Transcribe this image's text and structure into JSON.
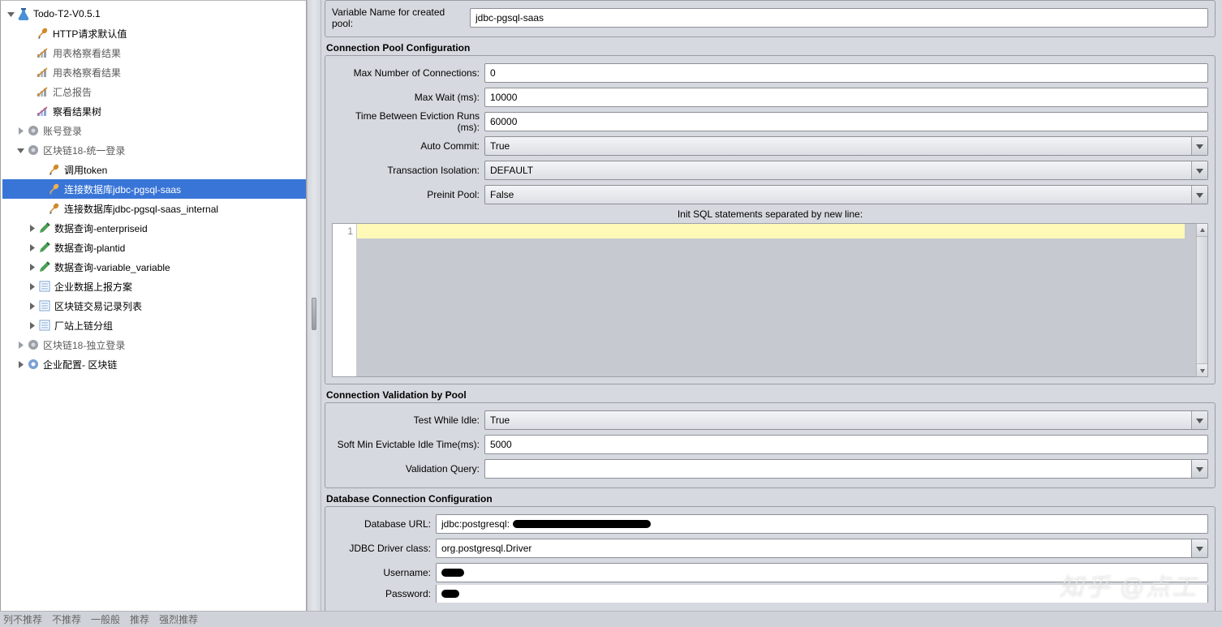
{
  "tree": {
    "root": "Todo-T2-V0.5.1",
    "http_defaults": "HTTP请求默认值",
    "table_result_1": "用表格察看结果",
    "table_result_2": "用表格察看结果",
    "summary_report": "汇总报告",
    "view_results_tree": "察看结果树",
    "account_login": "账号登录",
    "blockchain18_unified": "区块链18-统一登录",
    "call_token": "调用token",
    "db_pgsql_saas": "连接数据库jdbc-pgsql-saas",
    "db_pgsql_saas_internal": "连接数据库jdbc-pgsql-saas_internal",
    "query_enterpriseid": "数据查询-enterpriseid",
    "query_plantid": "数据查询-plantid",
    "query_variable": "数据查询-variable_variable",
    "upload_scheme": "企业数据上报方案",
    "tx_record_list": "区块链交易记录列表",
    "plant_chain_group": "厂站上链分组",
    "blockchain18_indep": "区块链18-独立登录",
    "enterprise_config": "企业配置- 区块链"
  },
  "top": {
    "var_name_label": "Variable Name for created pool:",
    "var_name_value": "jdbc-pgsql-saas"
  },
  "sections": {
    "pool_conf": "Connection Pool Configuration",
    "validation": "Connection Validation by Pool",
    "db_conf": "Database Connection Configuration"
  },
  "pool": {
    "max_conn_label": "Max Number of Connections:",
    "max_conn_value": "0",
    "max_wait_label": "Max Wait (ms):",
    "max_wait_value": "10000",
    "evict_label": "Time Between Eviction Runs (ms):",
    "evict_value": "60000",
    "auto_commit_label": "Auto Commit:",
    "auto_commit_value": "True",
    "tx_iso_label": "Transaction Isolation:",
    "tx_iso_value": "DEFAULT",
    "preinit_label": "Preinit Pool:",
    "preinit_value": "False",
    "init_sql_banner": "Init SQL statements separated by new line:",
    "gutter_1": "1"
  },
  "validation": {
    "test_idle_label": "Test While Idle:",
    "test_idle_value": "True",
    "soft_min_label": "Soft Min Evictable Idle Time(ms):",
    "soft_min_value": "5000",
    "val_query_label": "Validation Query:",
    "val_query_value": ""
  },
  "db": {
    "url_label": "Database URL:",
    "url_value": "jdbc:postgresql:",
    "driver_label": "JDBC Driver class:",
    "driver_value": "org.postgresql.Driver",
    "user_label": "Username:",
    "user_value": "",
    "pass_label": "Password:",
    "pass_value": ""
  },
  "footer": {
    "a": "列不推荐",
    "b": "不推荐",
    "c": "一般般",
    "d": "推荐",
    "e": "强烈推荐"
  },
  "watermark": "知乎 @点工"
}
